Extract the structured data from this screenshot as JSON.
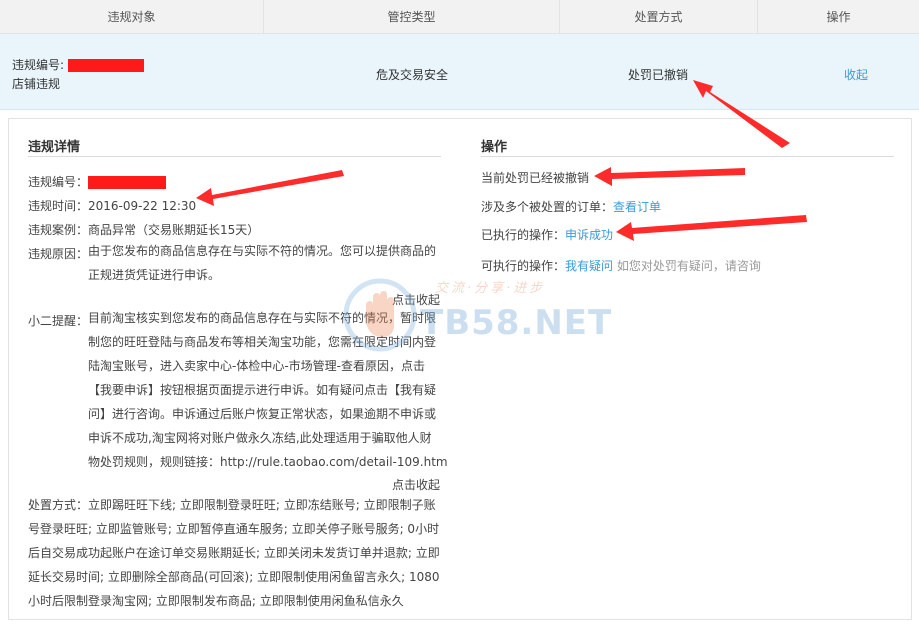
{
  "table": {
    "headers": [
      "违规对象",
      "管控类型",
      "处置方式",
      "操作"
    ],
    "row": {
      "id_label": "违规编号:",
      "type_label": "店铺违规",
      "control_type": "危及交易安全",
      "disposal": "处罚已撤销",
      "action": "收起"
    }
  },
  "details": {
    "title": "违规详情",
    "id_label": "违规编号：",
    "time_label": "违规时间：",
    "time_value": "2016-09-22 12:30",
    "case_label": "违规案例：",
    "case_value": "商品异常（交易账期延长15天）",
    "reason_label": "违规原因：",
    "reason_lines": [
      "由于您发布的商品信息存在与实际不符的情况。您可以提供商品的",
      "正规进货凭证进行申诉。"
    ],
    "collapse1": "点击收起",
    "tip_label": "小二提醒：",
    "tip_lines": [
      "目前淘宝核实到您发布的商品信息存在与实际不符的情况，暂时限",
      "制您的旺旺登陆与商品发布等相关淘宝功能，您需在限定时间内登",
      "陆淘宝账号，进入卖家中心-体检中心-市场管理-查看原因，点击",
      "【我要申诉】按钮根据页面提示进行申诉。如有疑问点击【我有疑",
      "问】进行咨询。申诉通过后账户恢复正常状态，如果逾期不申诉或",
      "申诉不成功,淘宝网将对账户做永久冻结,此处理适用于骗取他人财",
      "物处罚规则，规则链接：http://rule.taobao.com/detail-109.htm"
    ],
    "collapse2": "点击收起",
    "disposal_lines": [
      "处置方式：立即踢旺旺下线; 立即限制登录旺旺; 立即冻结账号; 立即限制子账",
      "号登录旺旺; 立即监管账号; 立即暂停直通车服务; 立即关停子账号服务; 0小时",
      "后自交易成功起账户在途订单交易账期延长; 立即关闭未发货订单并退款; 立即",
      "延长交易时间; 立即删除全部商品(可回滚); 立即限制使用闲鱼留言永久; 1080",
      "小时后限制登录淘宝网; 立即限制发布商品; 立即限制使用闲鱼私信永久"
    ]
  },
  "operations": {
    "title": "操作",
    "revoked": "当前处罚已经被撤销",
    "orders_label": "涉及多个被处置的订单：",
    "orders_link": "查看订单",
    "executed_label": "已执行的操作：",
    "executed_link": "申诉成功",
    "available_label": "可执行的操作：",
    "available_link": "我有疑问",
    "available_hint": "如您对处罚有疑问，请咨询"
  },
  "watermark": {
    "brand": "TB58.NET",
    "slogan": "交流·分享·进步"
  },
  "colors": {
    "link": "#3a9bd8",
    "redaction": "#ff1a1a",
    "arrow": "#ff2b2b",
    "row_highlight": "#e9f5fb"
  }
}
